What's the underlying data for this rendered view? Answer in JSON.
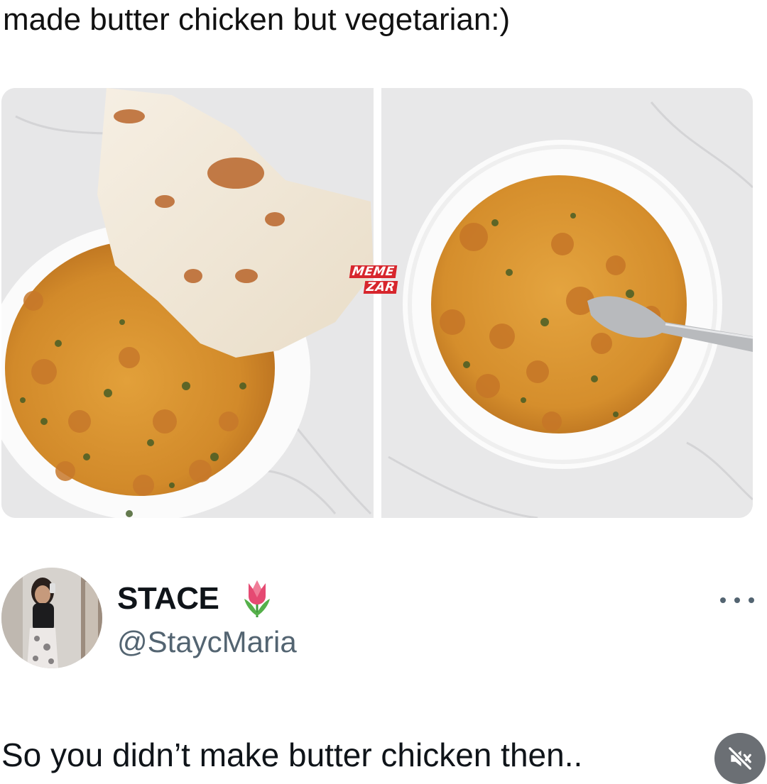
{
  "post": {
    "caption": "made butter chicken but vegetarian:)"
  },
  "watermark": {
    "line1": "MEME",
    "line2": "ZAR"
  },
  "reply": {
    "display_name": "STACE",
    "name_emoji": "tulip-icon",
    "handle": "@StaycMaria",
    "text": "So you didn’t make butter chicken then..",
    "more_icon": "more-horizontal-icon"
  },
  "media_controls": {
    "mute_icon": "speaker-muted-icon"
  },
  "colors": {
    "text_primary": "#0f1419",
    "text_secondary": "#536471",
    "curry": "#d9922f",
    "watermark_red": "#d7262d",
    "mute_button_bg": "#6b6f74"
  }
}
